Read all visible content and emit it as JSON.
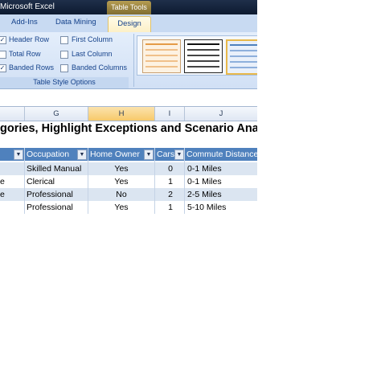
{
  "window": {
    "title": "Microsoft Excel",
    "context_tab": "Table Tools"
  },
  "tabs": [
    {
      "label": "Add-Ins"
    },
    {
      "label": "Data Mining"
    },
    {
      "label": "Design"
    }
  ],
  "options": {
    "header_row": {
      "label": "Header Row",
      "checked": true
    },
    "total_row": {
      "label": "Total Row",
      "checked": false
    },
    "banded_rows": {
      "label": "Banded Rows",
      "checked": true
    },
    "first_column": {
      "label": "First Column",
      "checked": false
    },
    "last_column": {
      "label": "Last Column",
      "checked": false
    },
    "banded_columns": {
      "label": "Banded Columns",
      "checked": false
    },
    "group_label": "Table Style Options"
  },
  "columns": [
    "G",
    "H",
    "I",
    "J"
  ],
  "sheet_title": "gories, Highlight Exceptions and Scenario Analys",
  "table": {
    "headers": [
      "Occupation",
      "Home Owner",
      "Cars",
      "Commute Distance"
    ],
    "first_col_fragments": [
      "",
      "e",
      "e",
      ""
    ],
    "rows": [
      [
        "Skilled Manual",
        "Yes",
        "0",
        "0-1 Miles"
      ],
      [
        "Clerical",
        "Yes",
        "1",
        "0-1 Miles"
      ],
      [
        "Professional",
        "No",
        "2",
        "2-5 Miles"
      ],
      [
        "Professional",
        "Yes",
        "1",
        "5-10 Miles"
      ]
    ]
  },
  "colors": {
    "header": "#4f81bd",
    "band": "#dbe5f1",
    "selected_col": "#f7c96a"
  }
}
